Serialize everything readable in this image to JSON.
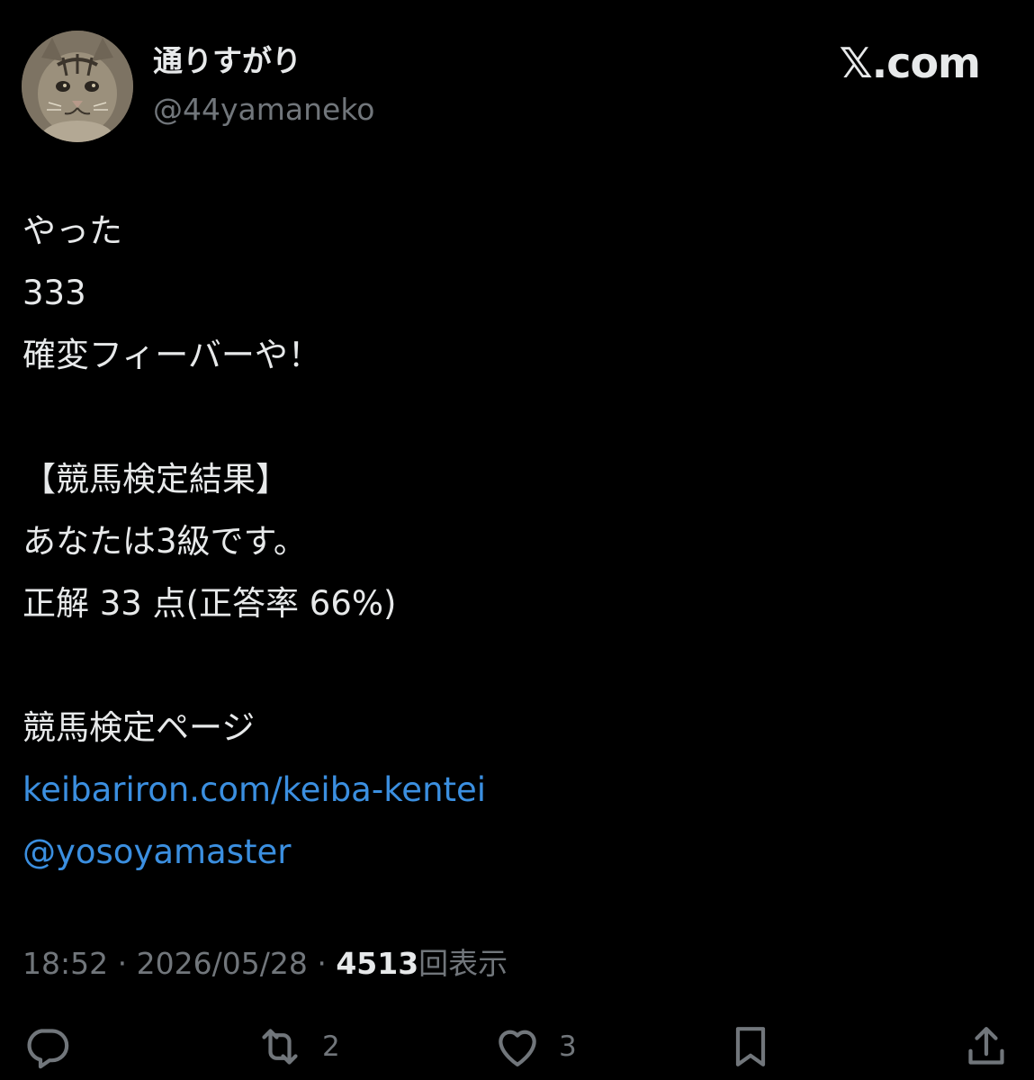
{
  "header": {
    "display_name": "通りすがり",
    "handle": "@44yamaneko",
    "brand": "𝕏.com"
  },
  "tweet": {
    "line1": "やった",
    "line2": "333",
    "line3": "確変フィーバーや！",
    "line4": "【競馬検定結果】",
    "line5": "あなたは3級です。",
    "line6": "正解 33 点(正答率 66%)",
    "line7": "競馬検定ページ",
    "link1": "keibariron.com/keiba-kentei",
    "link2": "@yosoyamaster"
  },
  "meta": {
    "time": "18:52",
    "separator": "·",
    "date": "2026/05/28",
    "views_count": "4513",
    "views_label": "回表示"
  },
  "actions": {
    "reply_icon": "reply-icon",
    "retweet_icon": "retweet-icon",
    "retweet_count": "2",
    "like_icon": "heart-icon",
    "like_count": "3",
    "bookmark_icon": "bookmark-icon",
    "share_icon": "share-icon"
  },
  "colors": {
    "background": "#000000",
    "text": "#e7e9ea",
    "muted": "#71767b",
    "link": "#3b8fe0"
  }
}
